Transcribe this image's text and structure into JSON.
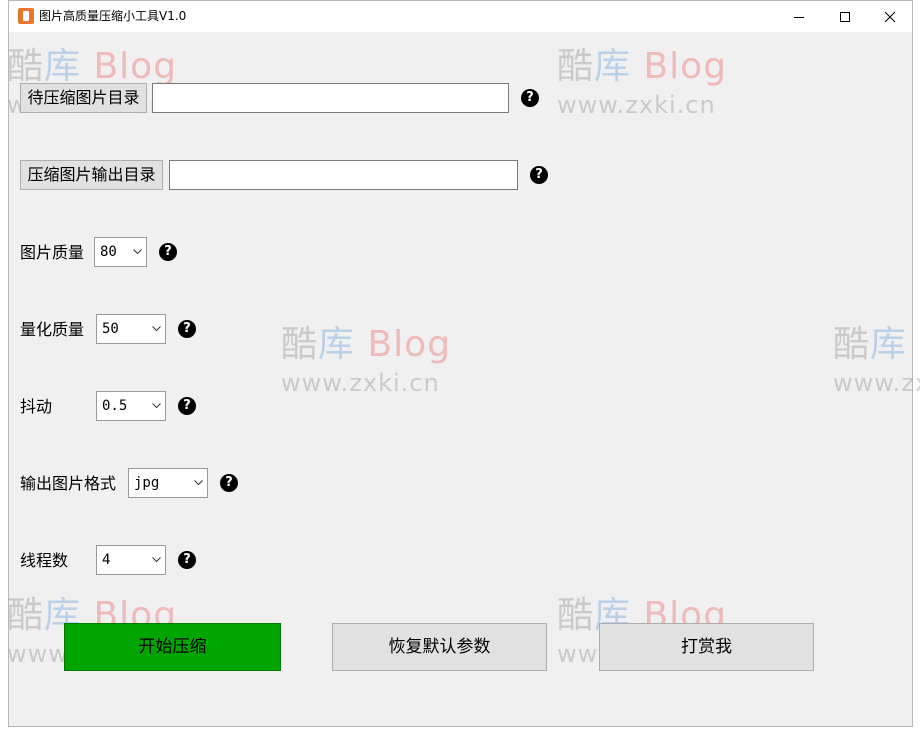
{
  "window": {
    "title": "图片高质量压缩小工具V1.0"
  },
  "watermark": {
    "brand_part1": "酷",
    "brand_part2": "库",
    "brand_part3": "Blog",
    "url": "www.zxki.cn"
  },
  "form": {
    "input_dir": {
      "button_label": "待压缩图片目录",
      "value": ""
    },
    "output_dir": {
      "button_label": "压缩图片输出目录",
      "value": ""
    },
    "image_quality": {
      "label": "图片质量",
      "value": "80"
    },
    "quant_quality": {
      "label": "量化质量",
      "value": "50"
    },
    "dither": {
      "label": "抖动",
      "value": "0.5"
    },
    "output_format": {
      "label": "输出图片格式",
      "value": "jpg"
    },
    "threads": {
      "label": "线程数",
      "value": "4"
    },
    "help_glyph": "?"
  },
  "actions": {
    "start_label": "开始压缩",
    "reset_label": "恢复默认参数",
    "tip_label": "打赏我"
  },
  "colors": {
    "start_button": "#00a500",
    "window_bg": "#f0f0f0"
  }
}
